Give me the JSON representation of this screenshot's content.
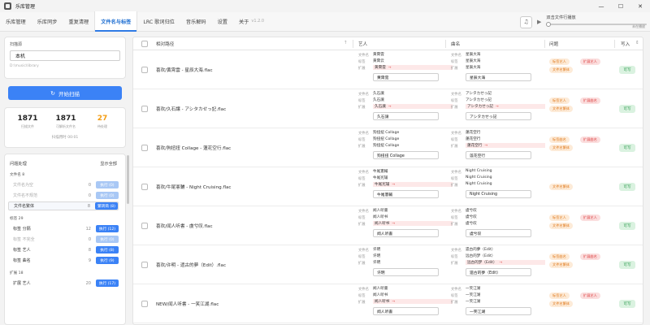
{
  "window": {
    "title": "乐库管理",
    "controls": [
      "—",
      "☐",
      "✕"
    ]
  },
  "tabs": [
    {
      "label": "乐库管理"
    },
    {
      "label": "乐库同步"
    },
    {
      "label": "重复清理"
    },
    {
      "label": "文件名与标签"
    },
    {
      "label": "LRC 歌词归位"
    },
    {
      "label": "音乐解码"
    },
    {
      "label": "设置"
    },
    {
      "label": "关于",
      "version": "v1.2.0"
    }
  ],
  "player": {
    "text": "双击文件行播放",
    "time": "未在播放",
    "progress": 0
  },
  "scan": {
    "label": "扫描源",
    "selected": "本机",
    "path": "D:\\music\\library",
    "button": "开始扫描"
  },
  "stats": {
    "scanned": "1871",
    "scanned_label": "扫描文件",
    "parsed": "1871",
    "parsed_label": "可解析文件名",
    "issues": "27",
    "issues_label": "待处理",
    "time": "扫描用时 00:01"
  },
  "issues": {
    "title": "问题处理",
    "show_all": "显示全部",
    "groups": [
      {
        "label": "文件名 8",
        "rows": [
          {
            "name": "文件名为空",
            "count": "0",
            "action": "执行 (0)",
            "state": "dim"
          },
          {
            "name": "文件名不规范",
            "count": "0",
            "action": "执行 (0)",
            "state": "dim"
          },
          {
            "name": "文件名繁体",
            "count": "8",
            "action": "繁转简 (8)",
            "state": "sel"
          }
        ]
      },
      {
        "label": "标签 29",
        "rows": [
          {
            "name": "标签 分隔",
            "count": "12",
            "action": "执行 (12)",
            "state": "on"
          },
          {
            "name": "标签 不完全",
            "count": "0",
            "action": "执行 (0)",
            "state": "dim"
          },
          {
            "name": "标签 艺人",
            "count": "8",
            "action": "执行 (8)",
            "state": "on"
          },
          {
            "name": "标签 曲名",
            "count": "9",
            "action": "执行 (9)",
            "state": "on"
          }
        ]
      },
      {
        "label": "扩展 18",
        "rows": [
          {
            "name": "扩展 艺人",
            "count": "20",
            "action": "执行 (17)",
            "state": "on"
          }
        ]
      }
    ]
  },
  "table": {
    "headers": {
      "path": "相对路径",
      "artist": "艺人",
      "title": "曲名",
      "issues": "问题",
      "write": "写入"
    },
    "field_labels": [
      "文件名",
      "标签",
      "扩展"
    ],
    "rows": [
      {
        "path": "喜欢/黄霄雲 - 星辰大海.flac",
        "artist": {
          "file": "黄霄雲",
          "tag": "黄霄云",
          "ext": "黄霄雲",
          "ext_arrow": true,
          "input": "黄霄雲"
        },
        "title": {
          "file": "星辰大海",
          "tag": "星辰大海",
          "ext": "星辰大海",
          "ext_arrow": false,
          "input": "星辰大海"
        },
        "pills": [
          {
            "text": "标签艺人",
            "c": "o"
          },
          {
            "text": "扩展艺人",
            "c": "r"
          },
          {
            "text": "文件名繁体",
            "c": "o"
          }
        ],
        "write": "可写"
      },
      {
        "path": "喜欢/久石譲 - アシタカせっ記.flac",
        "artist": {
          "file": "久石譲",
          "tag": "久石譲",
          "ext": "久石譲",
          "ext_arrow": true,
          "input": "久石譲"
        },
        "title": {
          "file": "アシタカせっ記",
          "tag": "アシタカせっ記",
          "ext": "アシタカせっ記",
          "ext_arrow": true,
          "input": "アシタカせっ記"
        },
        "pills": [
          {
            "text": "标签艺人",
            "c": "o"
          },
          {
            "text": "扩展曲名",
            "c": "r"
          },
          {
            "text": "文件名繁体",
            "c": "o"
          }
        ],
        "write": "可写"
      },
      {
        "path": "喜欢/狗扭扭 Collage - 蓮花空行.flac",
        "artist": {
          "file": "狗扭扭 Collage",
          "tag": "狗扭扭 Collage",
          "ext": "狗扭扭 Collage",
          "ext_arrow": false,
          "input": "狗扭扭 Collage"
        },
        "title": {
          "file": "蓮花空行",
          "tag": "蓮花空行",
          "ext": "蓮花空行",
          "ext_arrow": true,
          "input": "莲花空行"
        },
        "pills": [
          {
            "text": "标签曲名",
            "c": "o"
          },
          {
            "text": "扩展曲名",
            "c": "r"
          },
          {
            "text": "文件名繁体",
            "c": "o"
          }
        ],
        "write": "可写"
      },
      {
        "path": "喜欢/牛尾憲輔 - Night Cruising.flac",
        "artist": {
          "file": "牛尾憲輔",
          "tag": "牛尾宪辅",
          "ext": "牛尾宪辅",
          "ext_arrow": true,
          "input": "牛尾憲輔"
        },
        "title": {
          "file": "Night Cruising",
          "tag": "Night Cruising",
          "ext": "Night Cruising",
          "ext_arrow": false,
          "input": "Night Cruising"
        },
        "pills": [
          {
            "text": "文件名繁体",
            "c": "o"
          }
        ],
        "write": "可写"
      },
      {
        "path": "喜欢/闻人听書 - 虞兮叹.flac",
        "artist": {
          "file": "闻人听書",
          "tag": "闻人听书",
          "ext": "闻人听书",
          "ext_arrow": true,
          "input": "闻人听書"
        },
        "title": {
          "file": "虞兮叹",
          "tag": "虞兮叹",
          "ext": "虞兮叹",
          "ext_arrow": false,
          "input": "虞兮叹"
        },
        "pills": [
          {
            "text": "标签艺人",
            "c": "o"
          },
          {
            "text": "扩展艺人",
            "c": "r"
          },
          {
            "text": "文件名繁体",
            "c": "o"
          }
        ],
        "write": "可写"
      },
      {
        "path": "喜欢/许明 - 遗古的夢（Edit）.flac",
        "artist": {
          "file": "许明",
          "tag": "许明",
          "ext": "许明",
          "ext_arrow": false,
          "input": "许明"
        },
        "title": {
          "file": "遗古的夢（Edit）",
          "tag": "远古的梦（Edit）",
          "ext": "远古的梦（Edit）",
          "ext_arrow": true,
          "input": "遗古的夢（Edit）"
        },
        "pills": [
          {
            "text": "标签曲名",
            "c": "o"
          },
          {
            "text": "扩展曲名",
            "c": "r"
          },
          {
            "text": "文件名繁体",
            "c": "o"
          }
        ],
        "write": "可写"
      },
      {
        "path": "NEW/闻人听書 - 一笑江湖.flac",
        "artist": {
          "file": "闻人听書",
          "tag": "闻人听书",
          "ext": "闻人听书",
          "ext_arrow": true,
          "input": "闻人听書"
        },
        "title": {
          "file": "一笑江湖",
          "tag": "一笑江湖",
          "ext": "一笑江湖",
          "ext_arrow": false,
          "input": "一笑江湖"
        },
        "pills": [
          {
            "text": "标签艺人",
            "c": "o"
          },
          {
            "text": "扩展艺人",
            "c": "r"
          },
          {
            "text": "文件名繁体",
            "c": "o"
          }
        ],
        "write": "可写"
      }
    ]
  }
}
